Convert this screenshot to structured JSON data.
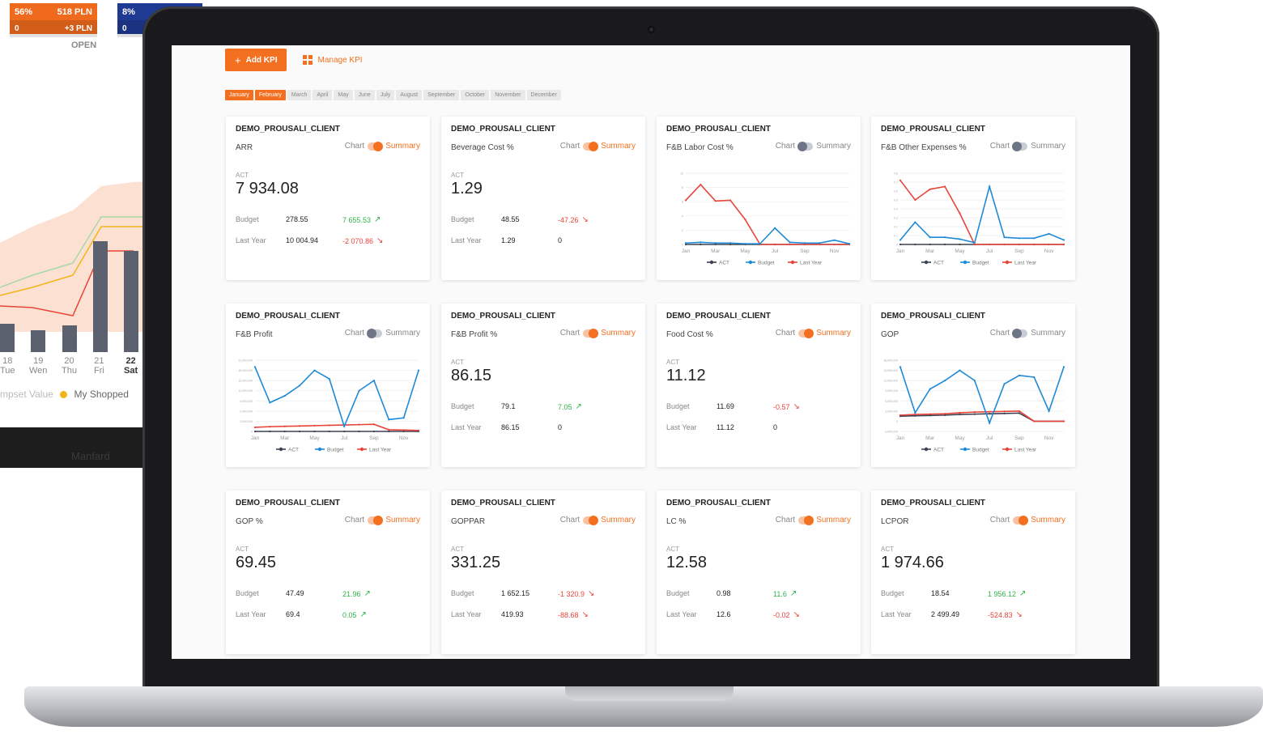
{
  "background_screen": {
    "tile_orange": {
      "pct": "56%",
      "amount": "518 PLN",
      "count": "0",
      "delta": "+3 PLN"
    },
    "tile_blue": {
      "pct": "8%",
      "count": "0"
    },
    "status": "OPEN",
    "days": [
      {
        "num": "18",
        "name": "Tue"
      },
      {
        "num": "19",
        "name": "Wen"
      },
      {
        "num": "20",
        "name": "Thu"
      },
      {
        "num": "21",
        "name": "Fri"
      },
      {
        "num": "22",
        "name": "Sat"
      }
    ],
    "legend_left": "mpset Value",
    "legend_right": "My Shopped",
    "taskbar_text": "Manfard"
  },
  "toolbar": {
    "add_label": "Add KPI",
    "manage_label": "Manage KPI"
  },
  "months": [
    "January",
    "February",
    "March",
    "April",
    "May",
    "June",
    "July",
    "August",
    "September",
    "October",
    "November",
    "December"
  ],
  "active_months": [
    0,
    1
  ],
  "colors": {
    "accent": "#f37021",
    "up": "#2cb34a",
    "down": "#e8443a",
    "act": "#3a4150",
    "budget": "#1e8ad6",
    "last_year": "#e8443a"
  },
  "cards": [
    {
      "client": "DEMO_PROUSALI_CLIENT",
      "kpi": "ARR",
      "chart_label": "Chart",
      "summary_label": "Summary",
      "mode": "summary",
      "act_label": "ACT",
      "act": "7 934.08",
      "budget_label": "Budget",
      "budget": "278.55",
      "budget_delta": "7 655.53",
      "budget_trend": "up",
      "ly_label": "Last Year",
      "last_year": "10 004.94",
      "ly_delta": "-2 070.86",
      "ly_trend": "down"
    },
    {
      "client": "DEMO_PROUSALI_CLIENT",
      "kpi": "Beverage Cost %",
      "chart_label": "Chart",
      "summary_label": "Summary",
      "mode": "summary",
      "act_label": "ACT",
      "act": "1.29",
      "budget_label": "Budget",
      "budget": "48.55",
      "budget_delta": "-47.26",
      "budget_trend": "down",
      "ly_label": "Last Year",
      "last_year": "1.29",
      "ly_delta": "0",
      "ly_trend": "flat"
    },
    {
      "client": "DEMO_PROUSALI_CLIENT",
      "kpi": "F&B Labor Cost %",
      "chart_label": "Chart",
      "summary_label": "Summary",
      "mode": "chart",
      "x_labels": [
        "Jan",
        "Mar",
        "May",
        "Jul",
        "Sep",
        "Nov"
      ],
      "legend": [
        "ACT",
        "Budget",
        "Last Year"
      ],
      "y_ticks": [
        "10",
        "8",
        "6",
        "4",
        "2",
        "0"
      ],
      "series": {
        "act": [
          0,
          0,
          0,
          0,
          0,
          0,
          0,
          0,
          0,
          0,
          0,
          0
        ],
        "budget": [
          0.2,
          0.3,
          0.2,
          0.2,
          0.1,
          0.1,
          2.3,
          0.3,
          0.2,
          0.2,
          0.6,
          0.1
        ],
        "last_year": [
          6.2,
          8.4,
          6.1,
          6.2,
          3.5,
          0,
          0,
          0,
          0,
          0,
          0,
          0
        ]
      },
      "y_max": 10,
      "y_min": 0
    },
    {
      "client": "DEMO_PROUSALI_CLIENT",
      "kpi": "F&B Other Expenses %",
      "chart_label": "Chart",
      "summary_label": "Summary",
      "mode": "chart",
      "x_labels": [
        "Jan",
        "Mar",
        "May",
        "Jul",
        "Sep",
        "Nov"
      ],
      "legend": [
        "ACT",
        "Budget",
        "Last Year"
      ],
      "y_ticks": [
        "0.8",
        "0.7",
        "0.6",
        "0.5",
        "0.4",
        "0.3",
        "0.2",
        "0.1",
        "0"
      ],
      "series": {
        "act": [
          0,
          0,
          0,
          0,
          0,
          0,
          0,
          0,
          0,
          0,
          0,
          0
        ],
        "budget": [
          0.05,
          0.25,
          0.08,
          0.08,
          0.06,
          0.02,
          0.65,
          0.08,
          0.07,
          0.07,
          0.12,
          0.05
        ],
        "last_year": [
          0.72,
          0.5,
          0.62,
          0.65,
          0.35,
          0,
          0,
          0,
          0,
          0,
          0,
          0
        ]
      },
      "y_max": 0.8,
      "y_min": 0
    },
    {
      "client": "DEMO_PROUSALI_CLIENT",
      "kpi": "F&B Profit",
      "chart_label": "Chart",
      "summary_label": "Summary",
      "mode": "chart",
      "x_labels": [
        "Jan",
        "Mar",
        "May",
        "Jul",
        "Sep",
        "Nov"
      ],
      "legend": [
        "ACT",
        "Budget",
        "Last Year"
      ],
      "y_ticks": [
        "21,000,000",
        "18,000,000",
        "15,000,000",
        "12,000,000",
        "9,000,000",
        "6,000,000",
        "3,000,000",
        "0"
      ],
      "series": {
        "act": [
          0,
          0,
          0,
          0,
          0,
          0,
          0,
          0,
          0,
          0,
          0,
          0
        ],
        "budget": [
          19000000,
          8500000,
          10500000,
          13500000,
          18000000,
          15500000,
          1500000,
          12000000,
          15000000,
          3500000,
          4000000,
          18000000
        ],
        "last_year": [
          1200000,
          1400000,
          1500000,
          1600000,
          1700000,
          1800000,
          1900000,
          2000000,
          2100000,
          500000,
          400000,
          300000
        ]
      },
      "y_max": 21000000,
      "y_min": 0
    },
    {
      "client": "DEMO_PROUSALI_CLIENT",
      "kpi": "F&B Profit %",
      "chart_label": "Chart",
      "summary_label": "Summary",
      "mode": "summary",
      "act_label": "ACT",
      "act": "86.15",
      "budget_label": "Budget",
      "budget": "79.1",
      "budget_delta": "7.05",
      "budget_trend": "up",
      "ly_label": "Last Year",
      "last_year": "86.15",
      "ly_delta": "0",
      "ly_trend": "flat"
    },
    {
      "client": "DEMO_PROUSALI_CLIENT",
      "kpi": "Food Cost %",
      "chart_label": "Chart",
      "summary_label": "Summary",
      "mode": "summary",
      "act_label": "ACT",
      "act": "11.12",
      "budget_label": "Budget",
      "budget": "11.69",
      "budget_delta": "-0.57",
      "budget_trend": "down",
      "ly_label": "Last Year",
      "last_year": "11.12",
      "ly_delta": "0",
      "ly_trend": "flat"
    },
    {
      "client": "DEMO_PROUSALI_CLIENT",
      "kpi": "GOP",
      "chart_label": "Chart",
      "summary_label": "Summary",
      "mode": "chart",
      "x_labels": [
        "Jan",
        "Mar",
        "May",
        "Jul",
        "Sep",
        "Nov"
      ],
      "legend": [
        "ACT",
        "Budget",
        "Last Year"
      ],
      "y_ticks": [
        "18,000,000",
        "15,000,000",
        "12,000,000",
        "9,000,000",
        "6,000,000",
        "3,000,000",
        "0",
        "-3,000,000"
      ],
      "series": {
        "act": [
          1500000,
          1600000,
          1700000,
          1800000,
          2000000,
          2100000,
          2200000,
          2300000,
          2400000,
          0,
          0,
          0
        ],
        "budget": [
          16000000,
          2500000,
          9500000,
          12000000,
          15000000,
          12000000,
          -500000,
          11000000,
          13500000,
          13000000,
          3000000,
          16000000
        ],
        "last_year": [
          1800000,
          2000000,
          2100000,
          2200000,
          2500000,
          2700000,
          2800000,
          2900000,
          3000000,
          0,
          0,
          0
        ]
      },
      "y_max": 18000000,
      "y_min": -3000000
    },
    {
      "client": "DEMO_PROUSALI_CLIENT",
      "kpi": "GOP %",
      "chart_label": "Chart",
      "summary_label": "Summary",
      "mode": "summary",
      "act_label": "ACT",
      "act": "69.45",
      "budget_label": "Budget",
      "budget": "47.49",
      "budget_delta": "21.96",
      "budget_trend": "up",
      "ly_label": "Last Year",
      "last_year": "69.4",
      "ly_delta": "0.05",
      "ly_trend": "up"
    },
    {
      "client": "DEMO_PROUSALI_CLIENT",
      "kpi": "GOPPAR",
      "chart_label": "Chart",
      "summary_label": "Summary",
      "mode": "summary",
      "act_label": "ACT",
      "act": "331.25",
      "budget_label": "Budget",
      "budget": "1 652.15",
      "budget_delta": "-1 320.9",
      "budget_trend": "down",
      "ly_label": "Last Year",
      "last_year": "419.93",
      "ly_delta": "-88.68",
      "ly_trend": "down"
    },
    {
      "client": "DEMO_PROUSALI_CLIENT",
      "kpi": "LC %",
      "chart_label": "Chart",
      "summary_label": "Summary",
      "mode": "summary",
      "act_label": "ACT",
      "act": "12.58",
      "budget_label": "Budget",
      "budget": "0.98",
      "budget_delta": "11.6",
      "budget_trend": "up",
      "ly_label": "Last Year",
      "last_year": "12.6",
      "ly_delta": "-0.02",
      "ly_trend": "down"
    },
    {
      "client": "DEMO_PROUSALI_CLIENT",
      "kpi": "LCPOR",
      "chart_label": "Chart",
      "summary_label": "Summary",
      "mode": "summary",
      "act_label": "ACT",
      "act": "1 974.66",
      "budget_label": "Budget",
      "budget": "18.54",
      "budget_delta": "1 956.12",
      "budget_trend": "up",
      "ly_label": "Last Year",
      "last_year": "2 499.49",
      "ly_delta": "-524.83",
      "ly_trend": "down"
    }
  ]
}
